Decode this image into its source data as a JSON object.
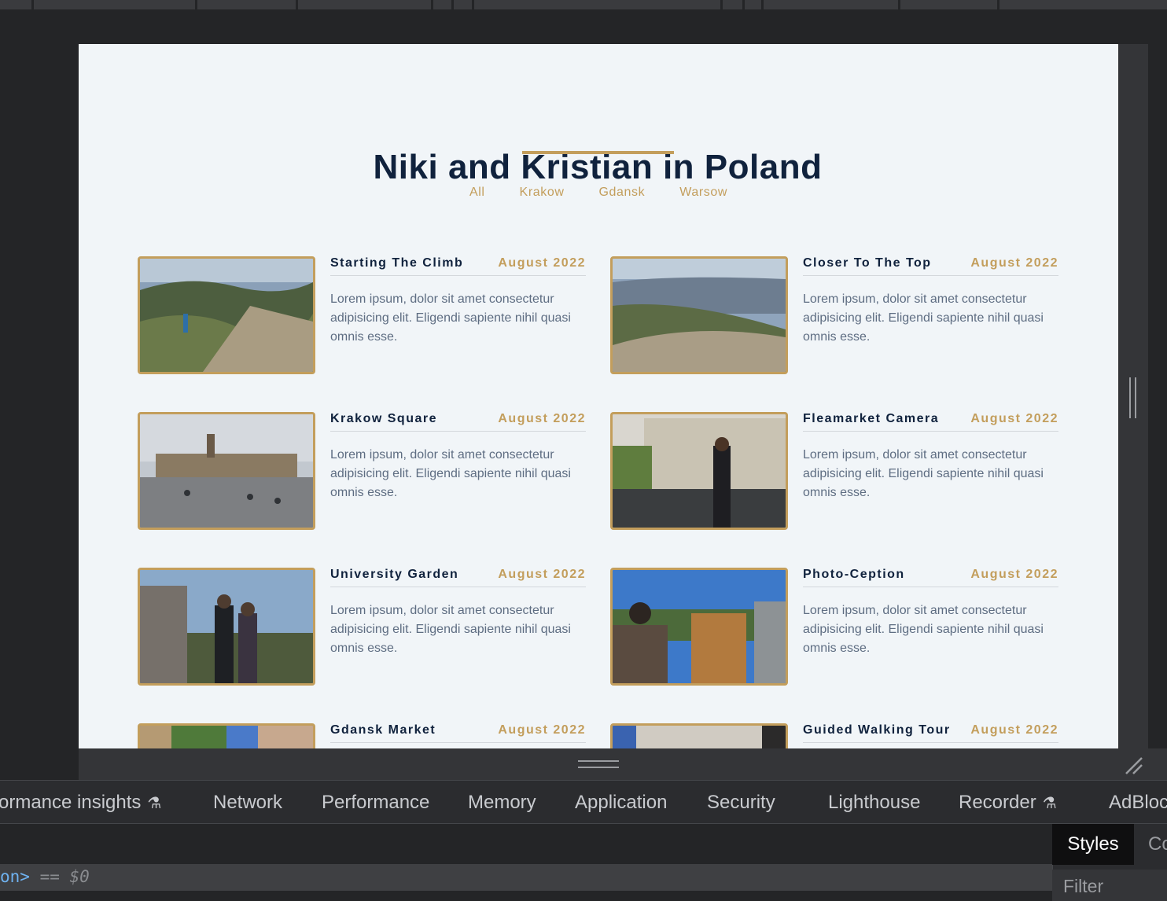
{
  "page": {
    "title": "Niki and Kristian in Poland",
    "filters": [
      "All",
      "Krakow",
      "Gdansk",
      "Warsow"
    ],
    "cards": [
      {
        "name": "Starting The Climb",
        "date": "August 2022",
        "text": "Lorem ipsum, dolor sit amet consectetur adipisicing elit. Eligendi sapiente nihil quasi omnis esse."
      },
      {
        "name": "Closer To The Top",
        "date": "August 2022",
        "text": "Lorem ipsum, dolor sit amet consectetur adipisicing elit. Eligendi sapiente nihil quasi omnis esse."
      },
      {
        "name": "Krakow Square",
        "date": "August 2022",
        "text": "Lorem ipsum, dolor sit amet consectetur adipisicing elit. Eligendi sapiente nihil quasi omnis esse."
      },
      {
        "name": "Fleamarket Camera",
        "date": "August 2022",
        "text": "Lorem ipsum, dolor sit amet consectetur adipisicing elit. Eligendi sapiente nihil quasi omnis esse."
      },
      {
        "name": "University Garden",
        "date": "August 2022",
        "text": "Lorem ipsum, dolor sit amet consectetur adipisicing elit. Eligendi sapiente nihil quasi omnis esse."
      },
      {
        "name": "Photo-Ception",
        "date": "August 2022",
        "text": "Lorem ipsum, dolor sit amet consectetur adipisicing elit. Eligendi sapiente nihil quasi omnis esse."
      },
      {
        "name": "Gdansk Market",
        "date": "August 2022",
        "text": ""
      },
      {
        "name": "Guided Walking Tour",
        "date": "August 2022",
        "text": ""
      }
    ]
  },
  "devtools": {
    "tabs": [
      "ormance insights",
      "Network",
      "Performance",
      "Memory",
      "Application",
      "Security",
      "Lighthouse",
      "Recorder",
      "AdBloc"
    ],
    "console": {
      "tag": "on>",
      "eq": " == ",
      "dollar": "$0"
    },
    "styles_tab": "Styles",
    "computed_tab": "Co",
    "filter_placeholder": "Filter"
  },
  "colors": {
    "accent": "#c39e5c",
    "title": "#10223d",
    "body_text": "#5e6d82",
    "page_bg": "#f1f5f8"
  }
}
